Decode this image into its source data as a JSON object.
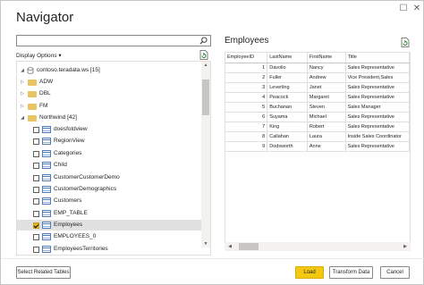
{
  "window": {
    "title": "Navigator",
    "maximize_glyph": "☐",
    "close_glyph": "✕"
  },
  "search": {
    "value": "",
    "placeholder": ""
  },
  "display_options": {
    "label": "Display Options",
    "chevron": "▾"
  },
  "tree": {
    "root": {
      "label": "contoso.teradata.ws [15]",
      "expander": "◢"
    },
    "folders": [
      {
        "label": "ADW",
        "expander": "▷"
      },
      {
        "label": "DBL",
        "expander": "▷"
      },
      {
        "label": "FM",
        "expander": "▷"
      },
      {
        "label": "Northwind [42]",
        "expander": "◢"
      }
    ],
    "items": [
      {
        "label": "doesfoldview",
        "checked": false
      },
      {
        "label": "RegionView",
        "checked": false
      },
      {
        "label": "Categories",
        "checked": false
      },
      {
        "label": "Child",
        "checked": false
      },
      {
        "label": "CustomerCustomerDemo",
        "checked": false
      },
      {
        "label": "CustomerDemographics",
        "checked": false
      },
      {
        "label": "Customers",
        "checked": false
      },
      {
        "label": "EMP_TABLE",
        "checked": false
      },
      {
        "label": "Employees",
        "checked": true
      },
      {
        "label": "EMPLOYEES_0",
        "checked": false
      },
      {
        "label": "EmployeesTerritories",
        "checked": false
      }
    ]
  },
  "scroll": {
    "up": "▲",
    "down": "▼",
    "left": "◀",
    "right": "▶"
  },
  "preview": {
    "title": "Employees",
    "columns": [
      "EmployeeID",
      "LastName",
      "FirstName",
      "Title"
    ],
    "rows": [
      [
        "1",
        "Davolio",
        "Nancy",
        "Sales Representative"
      ],
      [
        "2",
        "Fuller",
        "Andrew",
        "Vice President,Sales"
      ],
      [
        "3",
        "Leverling",
        "Janet",
        "Sales Representative"
      ],
      [
        "4",
        "Peacock",
        "Margaret",
        "Sales Representative"
      ],
      [
        "5",
        "Buchanan",
        "Steven",
        "Sales Manager"
      ],
      [
        "6",
        "Suyama",
        "Michael",
        "Sales Representative"
      ],
      [
        "7",
        "King",
        "Robert",
        "Sales Representative"
      ],
      [
        "8",
        "Callahan",
        "Laura",
        "Inside Sales Coordinator"
      ],
      [
        "9",
        "Dodsworth",
        "Anne",
        "Sales Representative"
      ]
    ]
  },
  "footer": {
    "select_related": "Select Related Tables",
    "load": "Load",
    "transform": "Transform Data",
    "cancel": "Cancel"
  },
  "colors": {
    "accent": "#f2c811",
    "folder": "#e8c463",
    "table_icon": "#4f7db9"
  }
}
